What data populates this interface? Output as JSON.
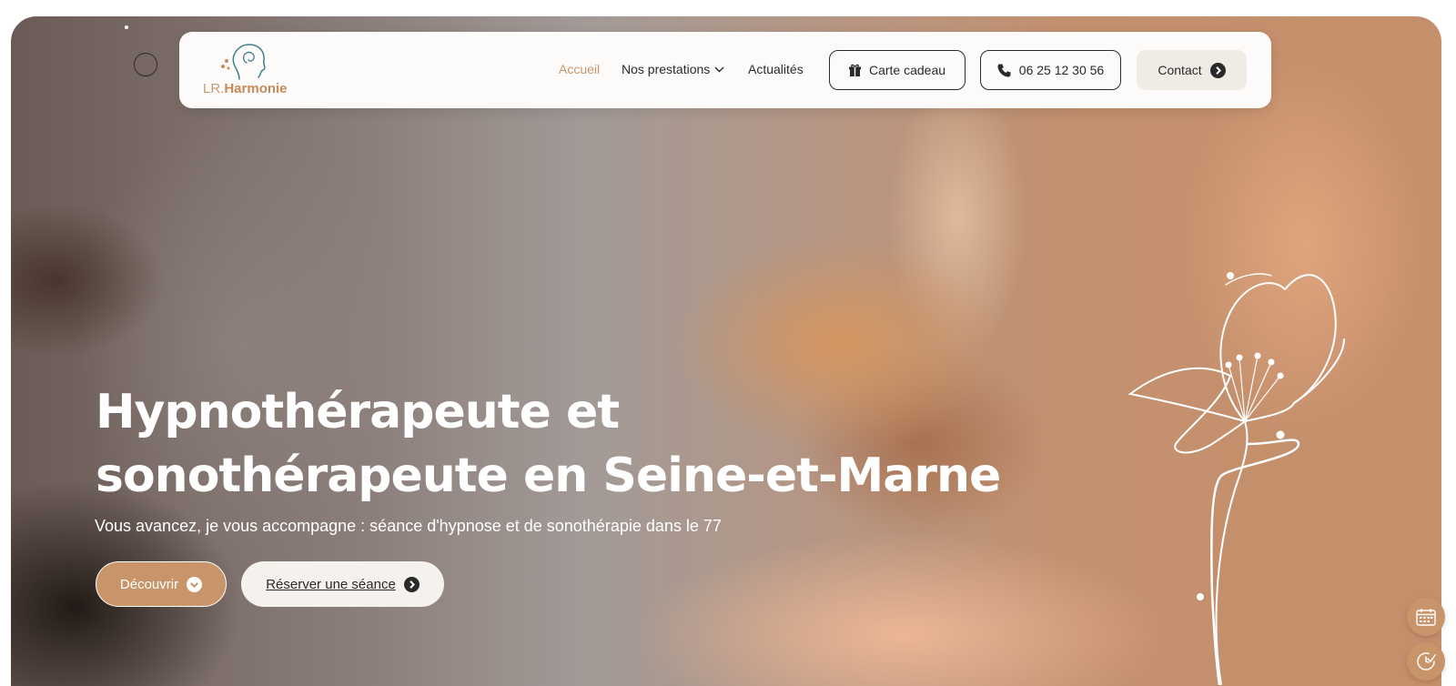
{
  "brand": {
    "logo_prefix": "LR.",
    "logo_name": "Harmonie",
    "icon": "head-lotus-logo-icon"
  },
  "nav": {
    "links": [
      {
        "label": "Accueil",
        "active": true
      },
      {
        "label": "Nos prestations",
        "active": false,
        "has_dropdown": true
      },
      {
        "label": "Actualités",
        "active": false
      }
    ],
    "gift_card_label": "Carte cadeau",
    "phone_label": "06 25 12 30 56",
    "contact_label": "Contact"
  },
  "hero": {
    "title_line1": "Hypnothérapeute et",
    "title_line2": "sonothérapeute en Seine-et-Marne",
    "subtitle": "Vous avancez, je vous accompagne : séance d'hypnose et de sonothérapie dans le 77",
    "discover_label": "Découvrir",
    "book_label": "Réserver une séance"
  },
  "floating": {
    "calendar_icon": "calendar-icon",
    "clock_check_icon": "clock-check-icon"
  },
  "colors": {
    "accent": "#c8956a",
    "dark": "#2a2a2a",
    "nav_bg": "#fdfbf9",
    "contact_bg": "#f1ebe5"
  }
}
